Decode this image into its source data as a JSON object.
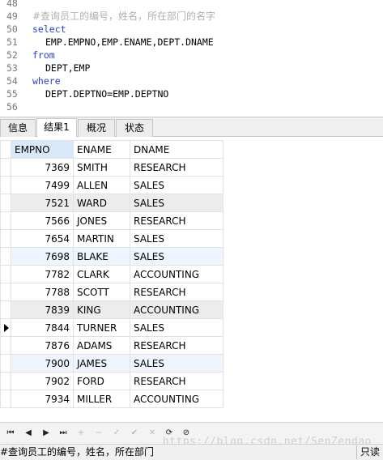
{
  "editor": {
    "lines": [
      {
        "no": "48",
        "text": ""
      },
      {
        "no": "49",
        "text": "#查询员工的编号，姓名，所在部门的名字"
      },
      {
        "no": "50",
        "text": "select"
      },
      {
        "no": "51",
        "text": "EMP.EMPNO,EMP.ENAME,DEPT.DNAME"
      },
      {
        "no": "52",
        "text": "from"
      },
      {
        "no": "53",
        "text": "DEPT,EMP"
      },
      {
        "no": "54",
        "text": "where"
      },
      {
        "no": "55",
        "text": "DEPT.DEPTNO=EMP.DEPTNO"
      },
      {
        "no": "56",
        "text": ""
      }
    ]
  },
  "tabs": [
    {
      "label": "信息"
    },
    {
      "label": "结果1"
    },
    {
      "label": "概况"
    },
    {
      "label": "状态"
    }
  ],
  "grid": {
    "columns": [
      "EMPNO",
      "ENAME",
      "DNAME"
    ],
    "rows": [
      [
        "7369",
        "SMITH",
        "RESEARCH"
      ],
      [
        "7499",
        "ALLEN",
        "SALES"
      ],
      [
        "7521",
        "WARD",
        "SALES"
      ],
      [
        "7566",
        "JONES",
        "RESEARCH"
      ],
      [
        "7654",
        "MARTIN",
        "SALES"
      ],
      [
        "7698",
        "BLAKE",
        "SALES"
      ],
      [
        "7782",
        "CLARK",
        "ACCOUNTING"
      ],
      [
        "7788",
        "SCOTT",
        "RESEARCH"
      ],
      [
        "7839",
        "KING",
        "ACCOUNTING"
      ],
      [
        "7844",
        "TURNER",
        "SALES"
      ],
      [
        "7876",
        "ADAMS",
        "RESEARCH"
      ],
      [
        "7900",
        "JAMES",
        "SALES"
      ],
      [
        "7902",
        "FORD",
        "RESEARCH"
      ],
      [
        "7934",
        "MILLER",
        "ACCOUNTING"
      ]
    ]
  },
  "navbar": {
    "buttons": [
      "first-record-icon",
      "prev-record-icon",
      "next-record-icon",
      "last-record-icon",
      "add-record-icon",
      "delete-record-icon",
      "edit-record-icon",
      "apply-icon",
      "cancel-icon",
      "refresh-icon",
      "stop-icon"
    ],
    "watermark": "https://blog.csdn.net/SenZendao"
  },
  "status": {
    "sql": "#查询员工的编号，姓名，所在部门",
    "mode": "只读"
  },
  "colors": {
    "keyword": "#2a3fd0",
    "comment": "#b0b0b0",
    "header_selected": "#d9e8fb",
    "row_shade_gray": "#ececec",
    "row_shade_blue": "#eef5fe"
  }
}
